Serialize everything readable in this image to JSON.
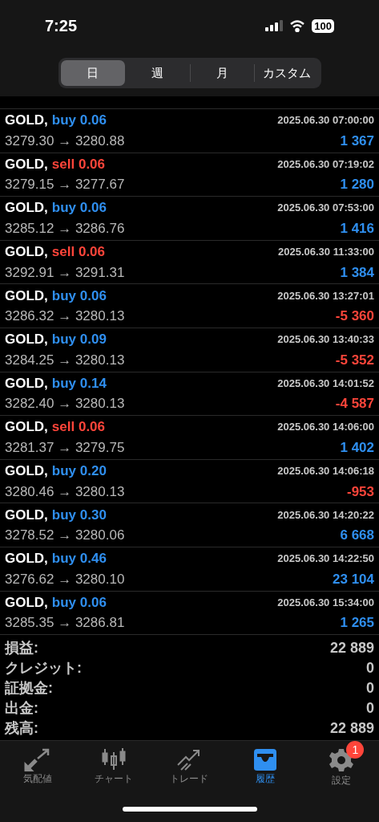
{
  "status_bar": {
    "time": "7:25",
    "battery": "100"
  },
  "period_tabs": [
    {
      "label": "日",
      "selected": true
    },
    {
      "label": "週",
      "selected": false
    },
    {
      "label": "月",
      "selected": false
    },
    {
      "label": "カスタム",
      "selected": false
    }
  ],
  "deals": [
    {
      "symbol": "GOLD,",
      "kind": "buy",
      "side": "buy 0.06",
      "time": "2025.06.30 07:00:00",
      "prices": "3279.30 → 3280.88",
      "profit": "1 367",
      "loss": false
    },
    {
      "symbol": "GOLD,",
      "kind": "sell",
      "side": "sell 0.06",
      "time": "2025.06.30 07:19:02",
      "prices": "3279.15 → 3277.67",
      "profit": "1 280",
      "loss": false
    },
    {
      "symbol": "GOLD,",
      "kind": "buy",
      "side": "buy 0.06",
      "time": "2025.06.30 07:53:00",
      "prices": "3285.12 → 3286.76",
      "profit": "1 416",
      "loss": false
    },
    {
      "symbol": "GOLD,",
      "kind": "sell",
      "side": "sell 0.06",
      "time": "2025.06.30 11:33:00",
      "prices": "3292.91 → 3291.31",
      "profit": "1 384",
      "loss": false
    },
    {
      "symbol": "GOLD,",
      "kind": "buy",
      "side": "buy 0.06",
      "time": "2025.06.30 13:27:01",
      "prices": "3286.32 → 3280.13",
      "profit": "-5 360",
      "loss": true
    },
    {
      "symbol": "GOLD,",
      "kind": "buy",
      "side": "buy 0.09",
      "time": "2025.06.30 13:40:33",
      "prices": "3284.25 → 3280.13",
      "profit": "-5 352",
      "loss": true
    },
    {
      "symbol": "GOLD,",
      "kind": "buy",
      "side": "buy 0.14",
      "time": "2025.06.30 14:01:52",
      "prices": "3282.40 → 3280.13",
      "profit": "-4 587",
      "loss": true
    },
    {
      "symbol": "GOLD,",
      "kind": "sell",
      "side": "sell 0.06",
      "time": "2025.06.30 14:06:00",
      "prices": "3281.37 → 3279.75",
      "profit": "1 402",
      "loss": false
    },
    {
      "symbol": "GOLD,",
      "kind": "buy",
      "side": "buy 0.20",
      "time": "2025.06.30 14:06:18",
      "prices": "3280.46 → 3280.13",
      "profit": "-953",
      "loss": true
    },
    {
      "symbol": "GOLD,",
      "kind": "buy",
      "side": "buy 0.30",
      "time": "2025.06.30 14:20:22",
      "prices": "3278.52 → 3280.06",
      "profit": "6 668",
      "loss": false
    },
    {
      "symbol": "GOLD,",
      "kind": "buy",
      "side": "buy 0.46",
      "time": "2025.06.30 14:22:50",
      "prices": "3276.62 → 3280.10",
      "profit": "23 104",
      "loss": false
    },
    {
      "symbol": "GOLD,",
      "kind": "buy",
      "side": "buy 0.06",
      "time": "2025.06.30 15:34:00",
      "prices": "3285.35 → 3286.81",
      "profit": "1 265",
      "loss": false
    }
  ],
  "summary": [
    {
      "label": "損益:",
      "value": "22 889"
    },
    {
      "label": "クレジット:",
      "value": "0"
    },
    {
      "label": "証拠金:",
      "value": "0"
    },
    {
      "label": "出金:",
      "value": "0"
    },
    {
      "label": "残高:",
      "value": "22 889"
    }
  ],
  "tab_bar": [
    {
      "kind": "quotes",
      "label": "気配値",
      "selected": false
    },
    {
      "kind": "chart",
      "label": "チャート",
      "selected": false
    },
    {
      "kind": "trade",
      "label": "トレード",
      "selected": false
    },
    {
      "kind": "history",
      "label": "履歴",
      "selected": true
    },
    {
      "kind": "settings",
      "label": "設定",
      "selected": false,
      "badge": "1"
    }
  ]
}
